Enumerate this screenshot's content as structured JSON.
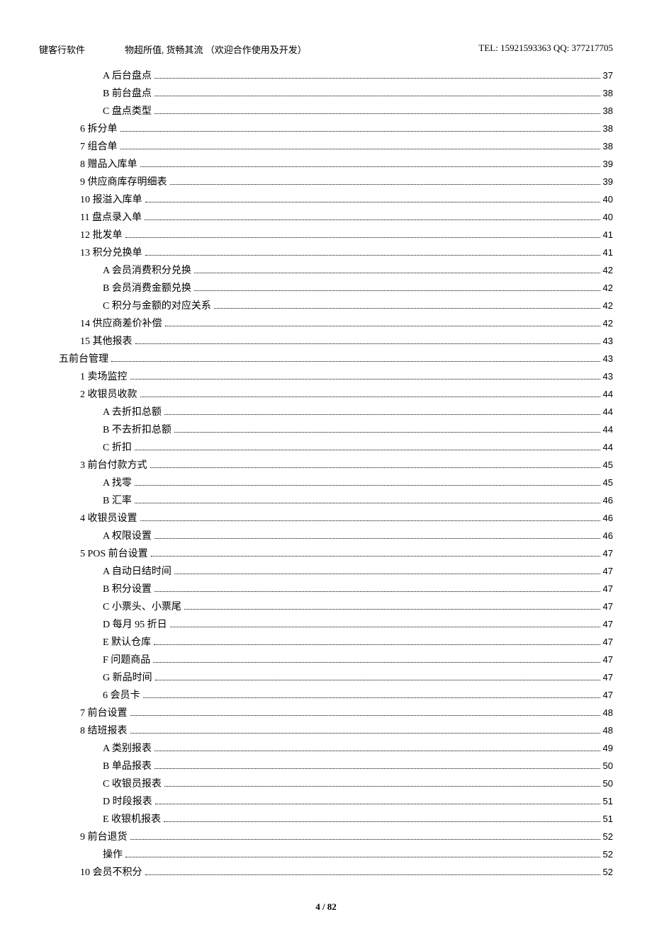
{
  "header": {
    "company": "键客行软件",
    "slogan": "物超所值, 货畅其流 （欢迎合作使用及开发）",
    "contact": "TEL: 15921593363 QQ: 377217705"
  },
  "toc": [
    {
      "level": 2,
      "title": "A 后台盘点",
      "page": "37"
    },
    {
      "level": 2,
      "title": "B 前台盘点",
      "page": "38"
    },
    {
      "level": 2,
      "title": "C 盘点类型",
      "page": "38"
    },
    {
      "level": 1,
      "title": "6 拆分单",
      "page": "38"
    },
    {
      "level": 1,
      "title": "7 组合单",
      "page": "38"
    },
    {
      "level": 1,
      "title": "8 赠品入库单",
      "page": "39"
    },
    {
      "level": 1,
      "title": "9 供应商库存明细表",
      "page": "39"
    },
    {
      "level": 1,
      "title": "10 报溢入库单",
      "page": "40"
    },
    {
      "level": 1,
      "title": "11 盘点录入单",
      "page": "40"
    },
    {
      "level": 1,
      "title": "12 批发单",
      "page": "41"
    },
    {
      "level": 1,
      "title": "13 积分兑换单",
      "page": "41"
    },
    {
      "level": 2,
      "title": "A 会员消费积分兑换",
      "page": "42"
    },
    {
      "level": 2,
      "title": "B 会员消费金额兑换",
      "page": "42"
    },
    {
      "level": 2,
      "title": "C 积分与金额的对应关系",
      "page": "42"
    },
    {
      "level": 1,
      "title": "14 供应商差价补偿",
      "page": "42"
    },
    {
      "level": 1,
      "title": "15 其他报表",
      "page": "43"
    },
    {
      "level": 0,
      "title": "五前台管理",
      "page": "43"
    },
    {
      "level": 1,
      "title": "1 卖场监控",
      "page": "43"
    },
    {
      "level": 1,
      "title": "2 收银员收款",
      "page": "44"
    },
    {
      "level": 2,
      "title": "A 去折扣总额",
      "page": "44"
    },
    {
      "level": 2,
      "title": "B 不去折扣总额",
      "page": "44"
    },
    {
      "level": 2,
      "title": "C 折扣",
      "page": "44"
    },
    {
      "level": 1,
      "title": "3 前台付款方式",
      "page": "45"
    },
    {
      "level": 2,
      "title": "A 找零",
      "page": "45"
    },
    {
      "level": 2,
      "title": "B 汇率",
      "page": "46"
    },
    {
      "level": 1,
      "title": "4 收银员设置",
      "page": "46"
    },
    {
      "level": 2,
      "title": "A 权限设置",
      "page": "46"
    },
    {
      "level": 1,
      "title": "5 POS 前台设置",
      "page": "47"
    },
    {
      "level": 2,
      "title": "A 自动日结时间",
      "page": "47"
    },
    {
      "level": 2,
      "title": "B 积分设置",
      "page": "47"
    },
    {
      "level": 2,
      "title": "C 小票头、小票尾",
      "page": "47"
    },
    {
      "level": 2,
      "title": "D 每月 95 折日",
      "page": "47"
    },
    {
      "level": 2,
      "title": "E 默认仓库",
      "page": "47"
    },
    {
      "level": 2,
      "title": "F 问题商品",
      "page": "47"
    },
    {
      "level": 2,
      "title": "G 新品时间",
      "page": "47"
    },
    {
      "level": 2,
      "title": "6 会员卡",
      "page": "47"
    },
    {
      "level": 1,
      "title": "7 前台设置",
      "page": "48"
    },
    {
      "level": 1,
      "title": "8 结班报表",
      "page": "48"
    },
    {
      "level": 2,
      "title": "A 类别报表",
      "page": "49"
    },
    {
      "level": 2,
      "title": "B 单品报表",
      "page": "50"
    },
    {
      "level": 2,
      "title": "C 收银员报表",
      "page": "50"
    },
    {
      "level": 2,
      "title": "D 时段报表",
      "page": "51"
    },
    {
      "level": 2,
      "title": "E 收银机报表",
      "page": "51"
    },
    {
      "level": 1,
      "title": "9 前台退货",
      "page": "52"
    },
    {
      "level": 2,
      "title": "操作",
      "page": "52"
    },
    {
      "level": 1,
      "title": "10 会员不积分",
      "page": "52"
    }
  ],
  "footer": {
    "page_label": "4 / 82"
  }
}
